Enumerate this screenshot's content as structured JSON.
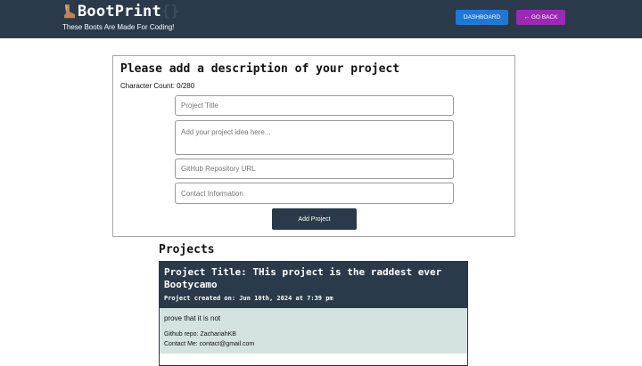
{
  "header": {
    "brand": "BootPrint",
    "brand_suffix": "{}",
    "tagline": "These Boots Are Made For Coding!",
    "dashboard_label": "DASHBOARD",
    "back_label": "← GO BACK",
    "logo_icon": "boot-icon"
  },
  "form": {
    "title": "Please add a description of your project",
    "char_count": "Character Count: 0/280",
    "title_placeholder": "Project Title",
    "idea_placeholder": "Add your project idea here...",
    "repo_placeholder": "GitHub Repository URL",
    "contact_placeholder": "Contact Information",
    "submit_label": "Add Project"
  },
  "projects": {
    "heading": "Projects",
    "items": [
      {
        "title": "Project Title: THis project is the raddest ever Bootycamo",
        "created": "Project created on: Jun 10th, 2024 at 7:39 pm",
        "description": "prove that it is not",
        "repo": "Github repo: ZachariahKB",
        "contact": "Contact Me: contact@gmail.com"
      }
    ]
  },
  "colors": {
    "header_bg": "#2b3a4a",
    "dashboard_btn": "#1e79d6",
    "back_btn": "#9a2ab3",
    "project_body_bg": "#d4e3e0"
  }
}
